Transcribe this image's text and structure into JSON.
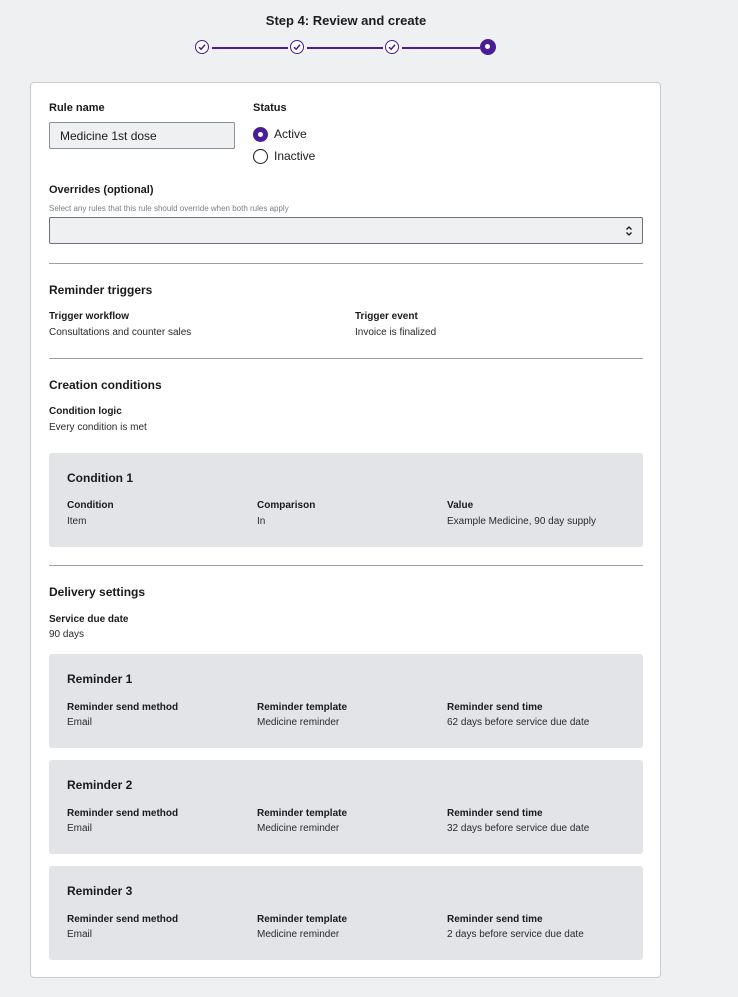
{
  "header": {
    "step_title": "Step 4: Review and create"
  },
  "stepper": {
    "total_steps": 4,
    "current_step": 4,
    "accent": "#4a1d96"
  },
  "form": {
    "rule_name_label": "Rule name",
    "rule_name_value": "Medicine 1st dose",
    "status_label": "Status",
    "status_options": [
      "Active",
      "Inactive"
    ],
    "status_selected": "Active",
    "overrides_label": "Overrides (optional)",
    "overrides_hint": "Select any rules that this rule should override when both rules apply",
    "overrides_value": ""
  },
  "triggers": {
    "title": "Reminder triggers",
    "workflow_label": "Trigger workflow",
    "workflow_value": "Consultations and counter sales",
    "event_label": "Trigger event",
    "event_value": "Invoice is finalized"
  },
  "creation": {
    "title": "Creation conditions",
    "logic_label": "Condition logic",
    "logic_value": "Every condition is met",
    "conditions": [
      {
        "title": "Condition 1",
        "condition_label": "Condition",
        "condition_value": "Item",
        "comparison_label": "Comparison",
        "comparison_value": "In",
        "value_label": "Value",
        "value_value": "Example Medicine, 90 day supply"
      }
    ]
  },
  "delivery": {
    "title": "Delivery settings",
    "due_label": "Service due date",
    "due_value": "90 days",
    "reminders": [
      {
        "title": "Reminder 1",
        "method_label": "Reminder send method",
        "method_value": "Email",
        "template_label": "Reminder template",
        "template_value": "Medicine reminder",
        "time_label": "Reminder send time",
        "time_value": "62 days before service due date"
      },
      {
        "title": "Reminder 2",
        "method_label": "Reminder send method",
        "method_value": "Email",
        "template_label": "Reminder template",
        "template_value": "Medicine reminder",
        "time_label": "Reminder send time",
        "time_value": "32 days before service due date"
      },
      {
        "title": "Reminder 3",
        "method_label": "Reminder send method",
        "method_value": "Email",
        "template_label": "Reminder template",
        "template_value": "Medicine reminder",
        "time_label": "Reminder send time",
        "time_value": "2 days before service due date"
      }
    ]
  }
}
